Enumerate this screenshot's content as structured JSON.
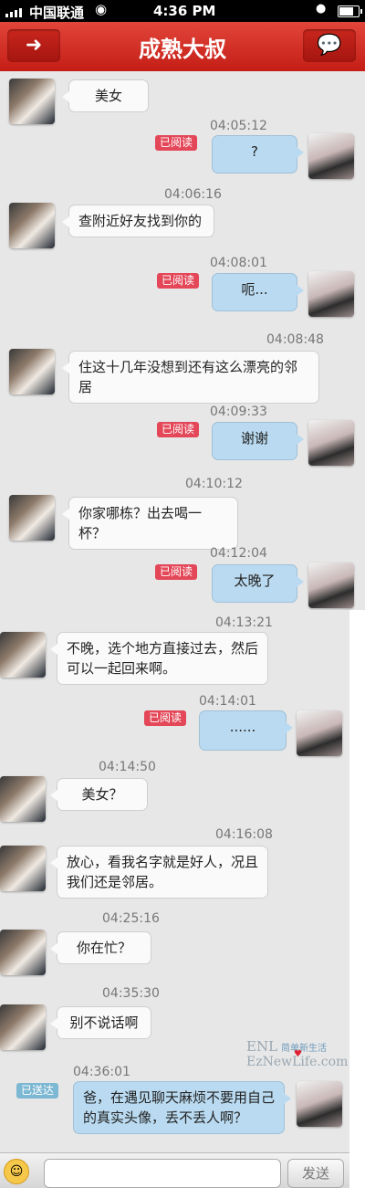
{
  "status": {
    "carrier": "中国联通",
    "time": "4:36 PM"
  },
  "nav": {
    "title": "成熟大叔",
    "back_icon": "left-arrow-icon",
    "chat_icon": "speech-bubble-icon"
  },
  "read_label": "已阅读",
  "sent_label": "已送达",
  "messages": [
    {
      "from": "other",
      "text": "美女"
    },
    {
      "time": "04:05:12"
    },
    {
      "from": "me",
      "text": "?",
      "status": "已阅读"
    },
    {
      "time": "04:06:16"
    },
    {
      "from": "other",
      "text": "查附近好友找到你的"
    },
    {
      "time": "04:08:01"
    },
    {
      "from": "me",
      "text": "呃...",
      "status": "已阅读"
    },
    {
      "time": "04:08:48"
    },
    {
      "from": "other",
      "text": "住这十几年没想到还有这么漂亮的邻居"
    },
    {
      "time": "04:09:33"
    },
    {
      "from": "me",
      "text": "谢谢",
      "status": "已阅读"
    },
    {
      "time": "04:10:12"
    },
    {
      "from": "other",
      "text": "你家哪栋？出去喝一杯？"
    },
    {
      "time": "04:12:04"
    },
    {
      "from": "me",
      "text": "太晚了",
      "status": "已阅读"
    },
    {
      "time": "04:13:21"
    },
    {
      "from": "other",
      "text": "不晚，选个地方直接过去，然后可以一起回来啊。"
    },
    {
      "time": "04:14:01"
    },
    {
      "from": "me",
      "text": "......",
      "status": "已阅读"
    },
    {
      "time": "04:14:50"
    },
    {
      "from": "other",
      "text": "美女？"
    },
    {
      "time": "04:16:08"
    },
    {
      "from": "other",
      "text": "放心，看我名字就是好人，况且我们还是邻居。"
    },
    {
      "time": "04:25:16"
    },
    {
      "from": "other",
      "text": "你在忙？"
    },
    {
      "time": "04:35:30"
    },
    {
      "from": "other",
      "text": "别不说话啊"
    },
    {
      "time": "04:36:01"
    },
    {
      "from": "me",
      "text": "爸，在遇见聊天麻烦不要用自己的真实头像，丢不丢人啊？",
      "status": "已送达"
    }
  ],
  "watermark": {
    "logo": "ENL",
    "tagline": "简单新生活",
    "site": "EzNewLife.com"
  },
  "input": {
    "placeholder": "",
    "send_label": "发送",
    "emoji_icon": "smiley-icon"
  }
}
